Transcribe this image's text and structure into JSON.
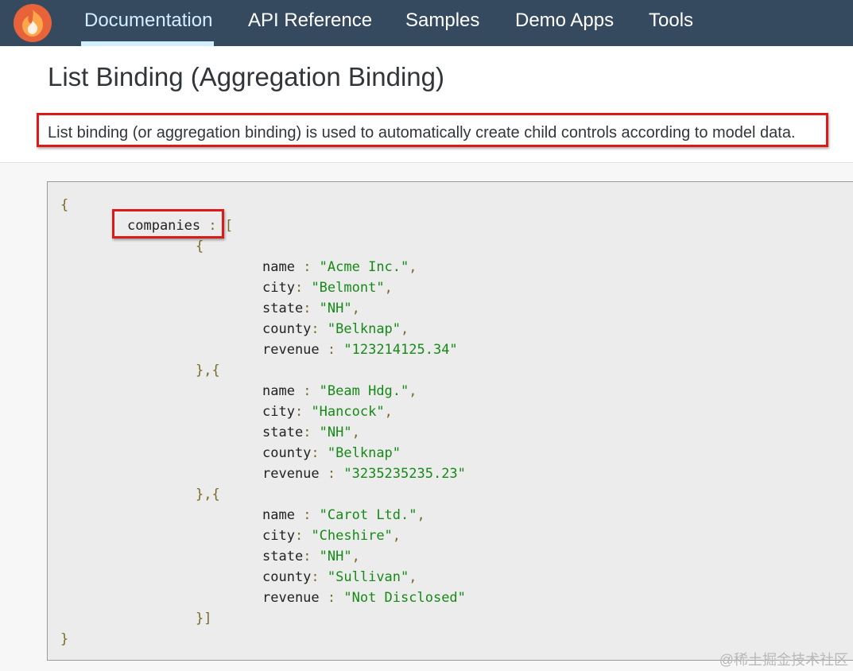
{
  "nav": {
    "tabs": [
      {
        "label": "Documentation",
        "active": true
      },
      {
        "label": "API Reference"
      },
      {
        "label": "Samples"
      },
      {
        "label": "Demo Apps"
      },
      {
        "label": "Tools"
      }
    ]
  },
  "page": {
    "title": "List Binding (Aggregation Binding)",
    "description": "List binding (or aggregation binding) is used to automatically create child controls according to model data."
  },
  "code": {
    "open_brace": "{",
    "close_brace": "}",
    "array_key": "companies",
    "array_open": " : [",
    "item_open": "{",
    "item_sep": "},{",
    "array_close": "}]",
    "companies": [
      {
        "name": "\"Acme Inc.\"",
        "city": "\"Belmont\"",
        "state": "\"NH\"",
        "county": "\"Belknap\"",
        "revenue": "\"123214125.34\""
      },
      {
        "name": "\"Beam Hdg.\"",
        "city": "\"Hancock\"",
        "state": "\"NH\"",
        "county": "\"Belknap\"",
        "revenue": "\"3235235235.23\""
      },
      {
        "name": "\"Carot Ltd.\"",
        "city": "\"Cheshire\"",
        "state": "\"NH\"",
        "county": "\"Sullivan\"",
        "revenue": "\"Not Disclosed\""
      }
    ],
    "labels": {
      "name": "name",
      "city": "city",
      "state": "state",
      "county": "county",
      "revenue": "revenue"
    },
    "seps": {
      "name": " : ",
      "city": ": ",
      "state": ": ",
      "county": ": ",
      "revenue": " : "
    },
    "trailing_commas": [
      {
        "name": ",",
        "city": ",",
        "state": ",",
        "county": ",",
        "revenue": ""
      },
      {
        "name": ",",
        "city": ",",
        "state": ",",
        "county": "",
        "revenue": ""
      },
      {
        "name": ",",
        "city": ",",
        "state": ",",
        "county": ",",
        "revenue": ""
      }
    ]
  },
  "colors": {
    "nav_bg": "#354a5f",
    "highlight_border": "#dd1a1a",
    "string": "#168a17"
  },
  "watermark": "@稀土掘金技术社区"
}
